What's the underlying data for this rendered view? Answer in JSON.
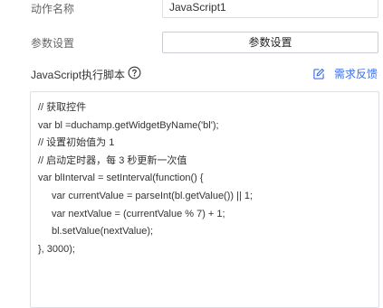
{
  "form": {
    "action_name_label": "动作名称",
    "action_name_value": "JavaScript1",
    "param_label": "参数设置",
    "param_button": "参数设置"
  },
  "script_section": {
    "title": "JavaScript执行脚本",
    "help_icon": "question-circle-icon",
    "feedback_icon": "edit-square-icon",
    "feedback_label": "需求反馈",
    "accent_color": "#3a6fe8"
  },
  "code": {
    "lines": [
      "// 获取控件",
      "var bl =duchamp.getWidgetByName('bl');",
      "// 设置初始值为 1",
      "// 启动定时器，每 3 秒更新一次值",
      "var blInterval = setInterval(function() {",
      "var currentValue = parseInt(bl.getValue()) || 1;",
      "var nextValue = (currentValue % 7) + 1;",
      "bl.setValue(nextValue);",
      "}, 3000);"
    ]
  }
}
